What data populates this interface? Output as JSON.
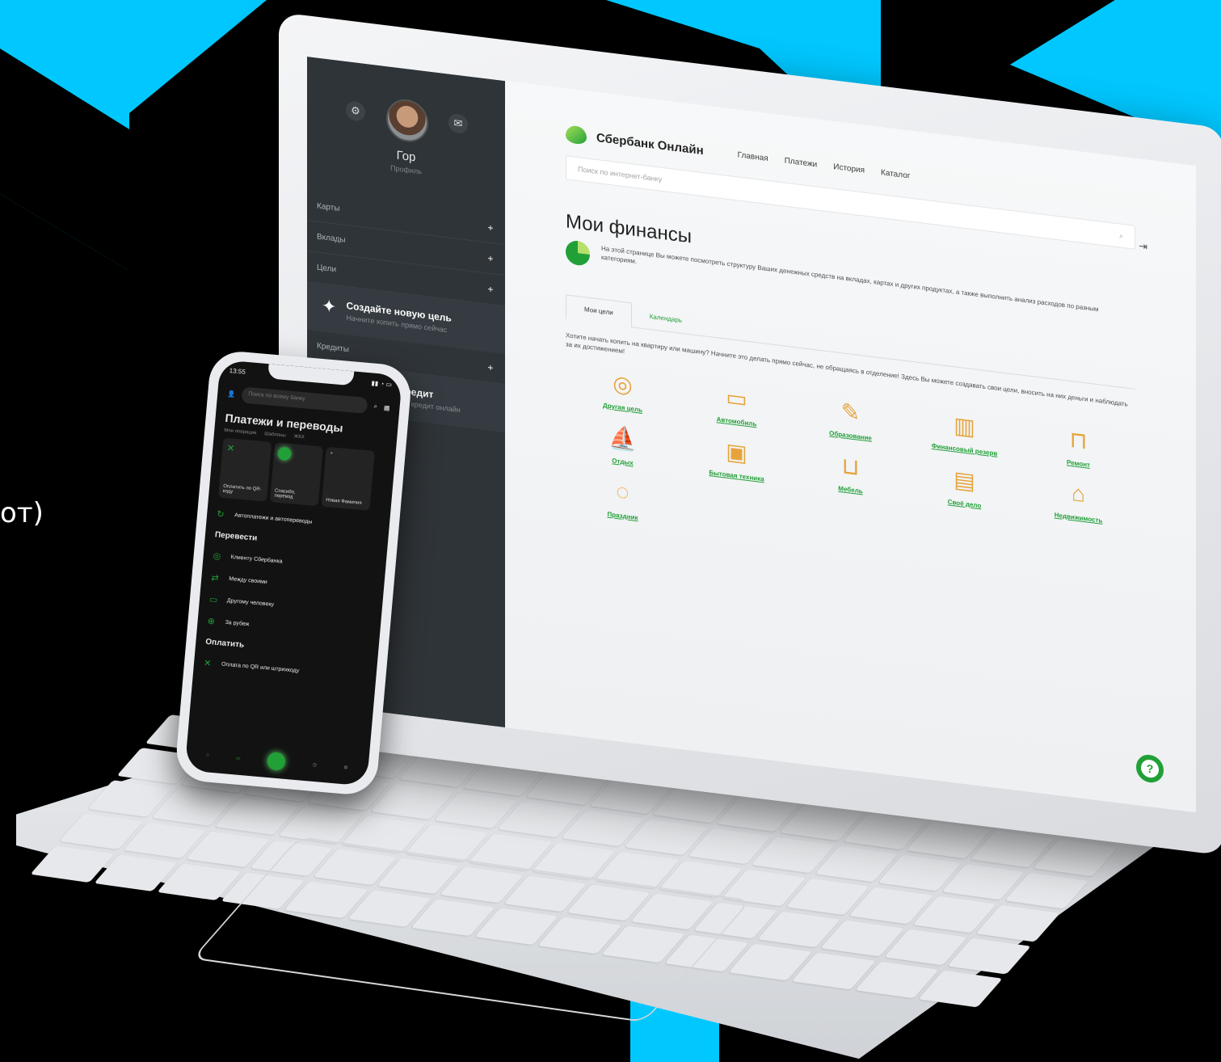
{
  "background": {
    "accent": "#00c8ff",
    "side_text": "от)"
  },
  "sidebar": {
    "name": "Гор",
    "profile": "Профиль",
    "sections": [
      "Карты",
      "Вклады",
      "Цели"
    ],
    "goal_card": {
      "title": "Создайте новую цель",
      "sub": "Начните копить прямо сейчас"
    },
    "credits": "Кредиты",
    "credit_card": {
      "title": "Оформить кредит",
      "sub": "Подайте заявку на кредит онлайн"
    }
  },
  "main": {
    "brand": "Сбербанк Онлайн",
    "nav": [
      "Главная",
      "Платежи",
      "История",
      "Каталог"
    ],
    "search_placeholder": "Поиск по интернет-банку",
    "title": "Мои финансы",
    "intro": "На этой странице Вы можете посмотреть структуру Ваших денежных средств на вкладах, картах и других продуктах, а также выполнить анализ расходов по разным категориям.",
    "tabs": [
      "Мои цели",
      "Календарь"
    ],
    "goals_intro": "Хотите начать копить на квартиру или машину? Начните это делать прямо сейчас, не обращаясь в отделение! Здесь Вы можете создавать свои цели, вносить на них деньги и наблюдать за их достижением!",
    "goals": [
      {
        "label": "Другая цель",
        "icon": "◎"
      },
      {
        "label": "Автомобиль",
        "icon": "▭"
      },
      {
        "label": "Образование",
        "icon": "✎"
      },
      {
        "label": "Финансовый резерв",
        "icon": "▥"
      },
      {
        "label": "Ремонт",
        "icon": "⊓"
      },
      {
        "label": "Отдых",
        "icon": "⛵"
      },
      {
        "label": "Бытовая техника",
        "icon": "▣"
      },
      {
        "label": "Мебель",
        "icon": "⊔"
      },
      {
        "label": "Своё дело",
        "icon": "▤"
      },
      {
        "label": "Недвижимость",
        "icon": "⌂"
      },
      {
        "label": "Праздник",
        "icon": "◌"
      }
    ],
    "brand_color": "#21a038"
  },
  "phone": {
    "time": "13:55",
    "search_placeholder": "Поиск по всему банку",
    "title": "Платежи и переводы",
    "subtabs": [
      "Мои операции",
      "Шаблоны",
      "ЖКХ"
    ],
    "tiles": [
      "Оплатить по QR-коду",
      "Спасибо, перевод",
      "Новая Фамилия"
    ],
    "autopay": "Автоплатежи и автопереводы",
    "transfer_section": "Перевести",
    "transfers": [
      "Клиенту Сбербанка",
      "Между своими",
      "Другому человеку",
      "За рубеж"
    ],
    "pay_section": "Оплатить",
    "pay_items": [
      "Оплата по QR или штрихкоду"
    ],
    "bottom_nav": [
      "Главный",
      "Платежи",
      "",
      "История",
      "Чат"
    ]
  }
}
